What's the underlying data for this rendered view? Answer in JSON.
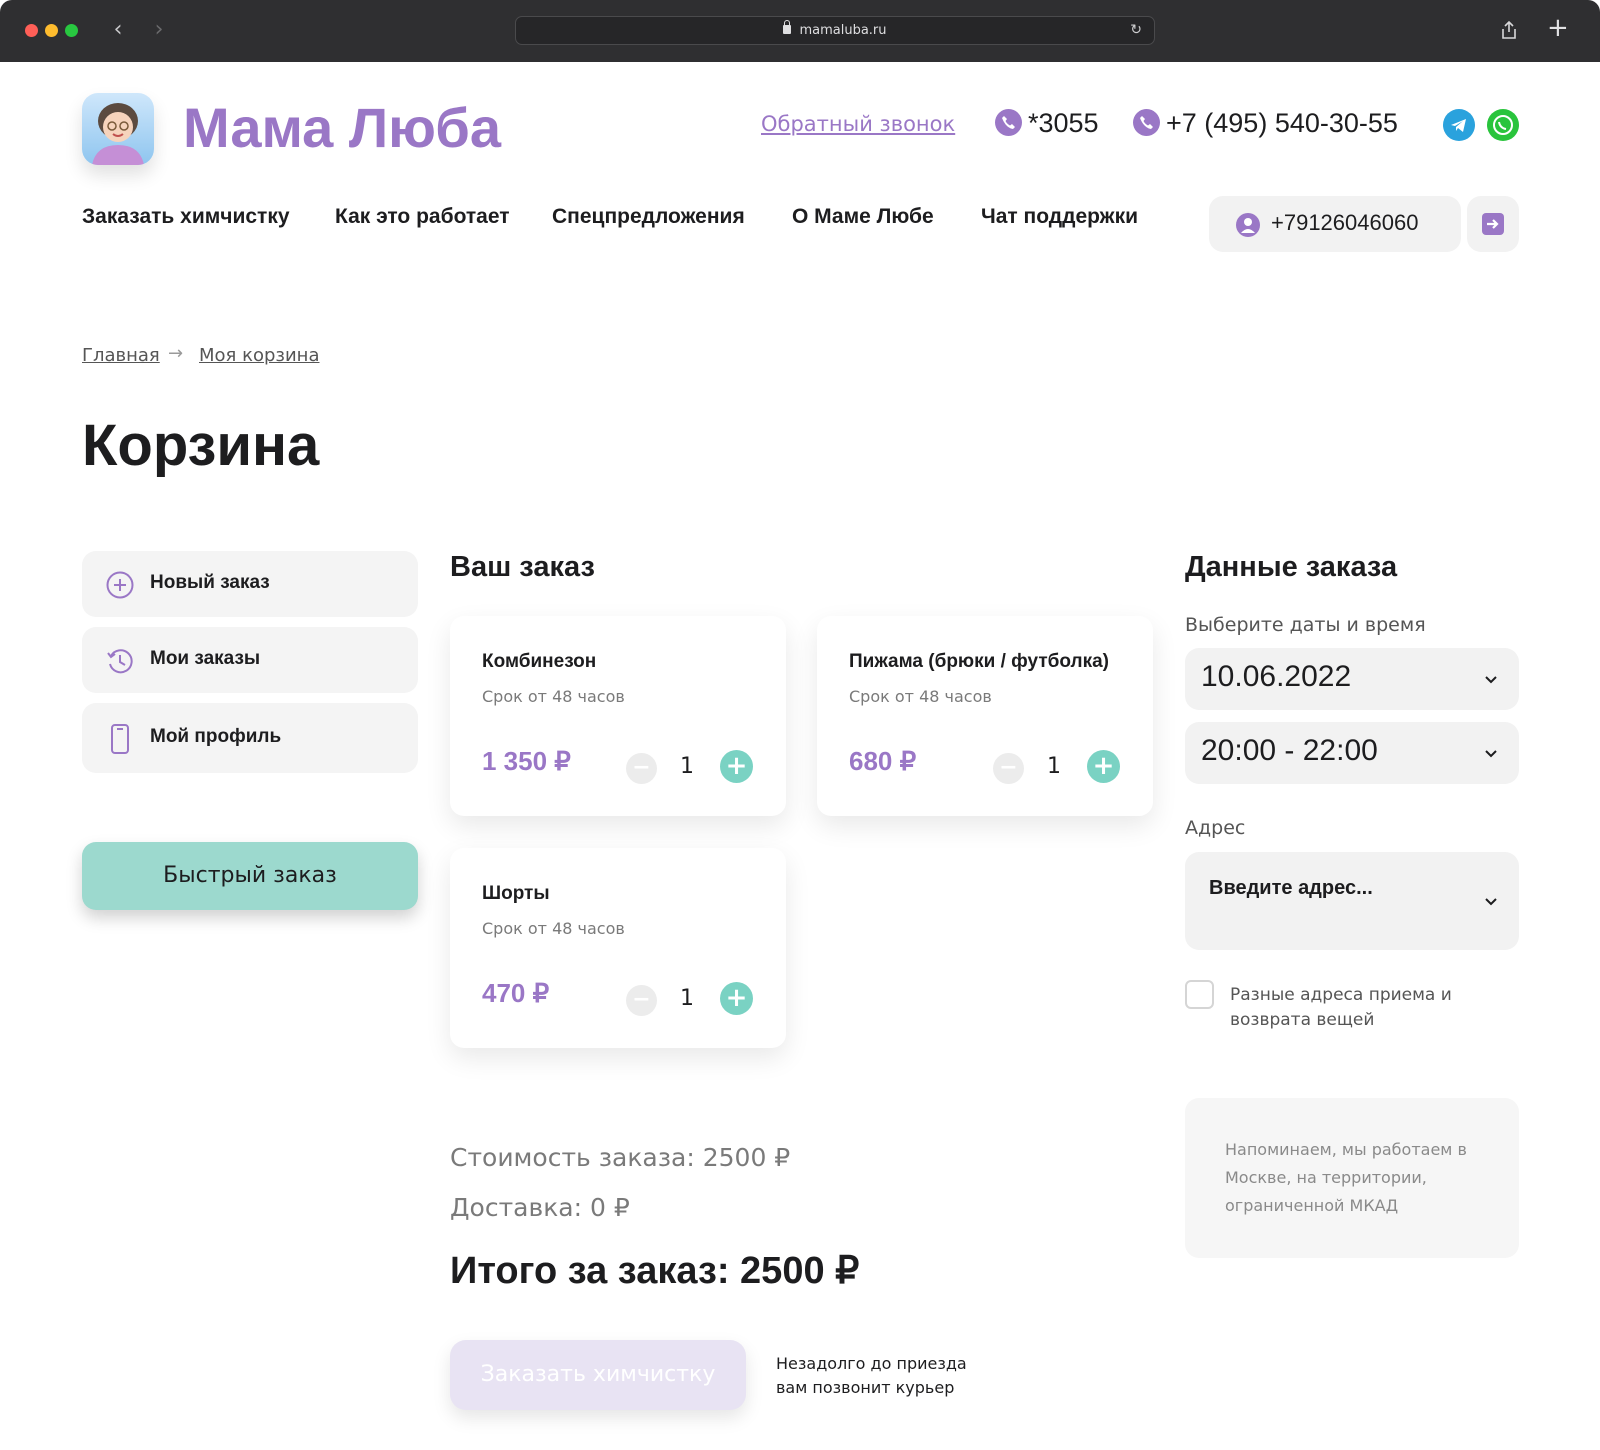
{
  "browser": {
    "url": "mamaluba.ru"
  },
  "header": {
    "brand": "Мама Люба",
    "callback": "Обратный звонок",
    "phone_short": "*3055",
    "phone_long": "+7 (495) 540-30-55"
  },
  "nav": {
    "items": [
      "Заказать химчистку",
      "Как это работает",
      "Спецпредложения",
      "О Маме Любе",
      "Чат поддержки"
    ],
    "account_phone": "+79126046060"
  },
  "breadcrumb": {
    "home": "Главная",
    "current": "Моя корзина"
  },
  "page": {
    "title": "Корзина"
  },
  "sidebar": {
    "items": [
      {
        "label": "Новый заказ"
      },
      {
        "label": "Мои заказы"
      },
      {
        "label": "Мой профиль"
      }
    ],
    "quick_order": "Быстрый заказ"
  },
  "order": {
    "title": "Ваш заказ",
    "items": [
      {
        "name": "Комбинезон",
        "term": "Срок от 48 часов",
        "price": "1 350 ₽",
        "qty": "1"
      },
      {
        "name": "Пижама (брюки / футболка)",
        "term": "Срок от 48 часов",
        "price": "680 ₽",
        "qty": "1"
      },
      {
        "name": "Шорты",
        "term": "Срок от 48 часов",
        "price": "470 ₽",
        "qty": "1"
      }
    ],
    "cost": "Стоимость заказа: 2500 ₽",
    "delivery": "Доставка: 0 ₽",
    "total": "Итого за заказ: 2500 ₽",
    "submit": "Заказать химчистку",
    "courier_note": "Незадолго до приезда вам позвонит курьер"
  },
  "details": {
    "title": "Данные заказа",
    "date_label": "Выберите даты и время",
    "date": "10.06.2022",
    "time": "20:00 - 22:00",
    "address_label": "Адрес",
    "address_placeholder": "Введите адрес...",
    "diff_address": "Разные адреса приема и возврата вещей",
    "notice": "Напоминаем, мы работаем в Москве, на территории, ограниченной МКАД"
  },
  "colors": {
    "brand": "#9a77c6",
    "accent": "#7ad2c3",
    "quick_button": "#9cd9ce"
  }
}
